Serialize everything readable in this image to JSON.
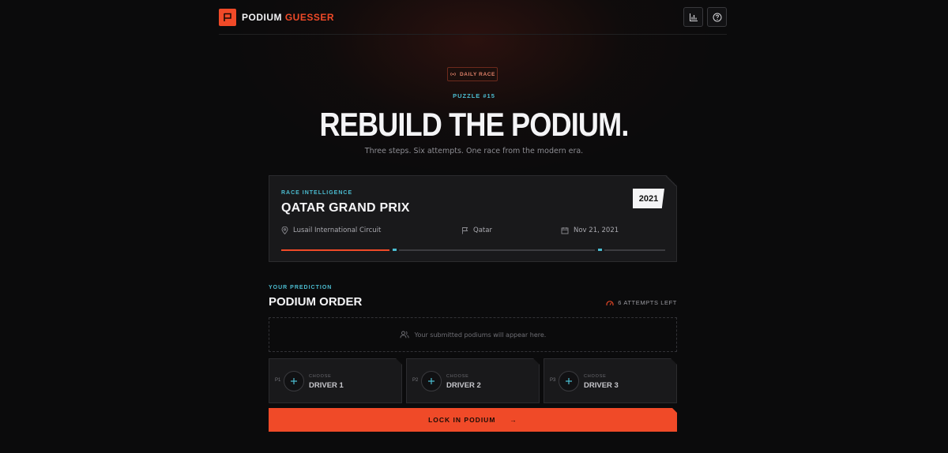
{
  "header": {
    "logo_word1": "PODIUM",
    "logo_word2": "GUESSER",
    "stats_icon": "bar-chart-icon",
    "help_icon": "help-circle-icon"
  },
  "hero": {
    "badge": "DAILY RACE",
    "puzzle": "PUZZLE #15",
    "title": "REBUILD THE PODIUM.",
    "subtitle": "Three steps. Six attempts. One race from the modern era."
  },
  "race": {
    "label": "RACE INTELLIGENCE",
    "name": "QATAR GRAND PRIX",
    "year": "2021",
    "circuit": "Lusail International Circuit",
    "country": "Qatar",
    "date": "Nov 21, 2021"
  },
  "prediction": {
    "label": "YOUR PREDICTION",
    "title": "PODIUM ORDER",
    "attempts": "6 ATTEMPTS LEFT",
    "empty_text": "Your submitted podiums will appear here.",
    "slots": [
      {
        "pos": "P1",
        "choose": "CHOOSE",
        "driver": "DRIVER 1"
      },
      {
        "pos": "P2",
        "choose": "CHOOSE",
        "driver": "DRIVER 2"
      },
      {
        "pos": "P3",
        "choose": "CHOOSE",
        "driver": "DRIVER 3"
      }
    ],
    "lock_label": "LOCK IN PODIUM",
    "lock_arrow": "→"
  },
  "colors": {
    "accent": "#f04a28",
    "cyan": "#4bbcd0",
    "background": "#0b0b0c",
    "card": "#19191b"
  }
}
